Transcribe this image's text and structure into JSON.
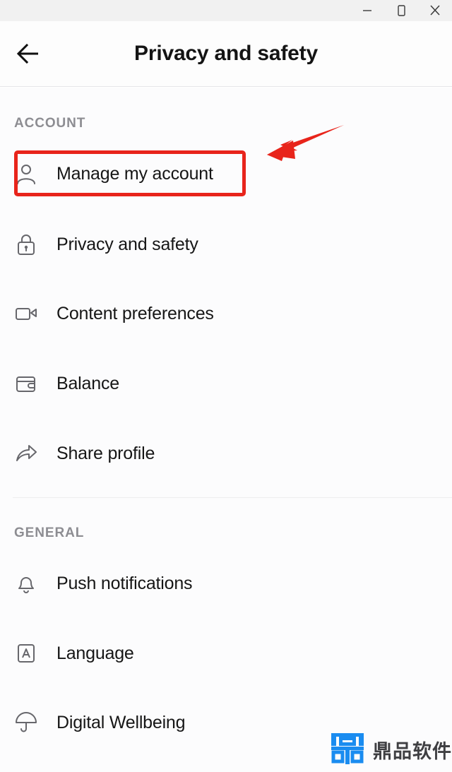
{
  "window": {
    "controls": [
      {
        "name": "minimize",
        "glyph": "minimize-icon"
      },
      {
        "name": "maximize",
        "glyph": "maximize-icon"
      },
      {
        "name": "close",
        "glyph": "close-icon"
      }
    ]
  },
  "header": {
    "back_icon": "arrow-left-icon",
    "title": "Privacy and safety"
  },
  "sections": [
    {
      "label": "ACCOUNT",
      "items": [
        {
          "label": "Manage my account",
          "icon": "person-icon",
          "highlighted": true
        },
        {
          "label": "Privacy and safety",
          "icon": "lock-icon",
          "highlighted": false
        },
        {
          "label": "Content preferences",
          "icon": "video-camera-icon",
          "highlighted": false
        },
        {
          "label": "Balance",
          "icon": "wallet-icon",
          "highlighted": false
        },
        {
          "label": "Share profile",
          "icon": "share-arrow-icon",
          "highlighted": false
        }
      ]
    },
    {
      "label": "GENERAL",
      "items": [
        {
          "label": "Push notifications",
          "icon": "bell-icon",
          "highlighted": false
        },
        {
          "label": "Language",
          "icon": "letter-a-box-icon",
          "highlighted": false
        },
        {
          "label": "Digital Wellbeing",
          "icon": "umbrella-icon",
          "highlighted": false
        }
      ]
    }
  ],
  "annotation": {
    "highlight_color": "#e8241b",
    "arrow_color": "#e8241b",
    "target_label": "Manage my account"
  },
  "watermark": {
    "text": "鼎品软件",
    "logo_color": "#1a8cf0"
  }
}
